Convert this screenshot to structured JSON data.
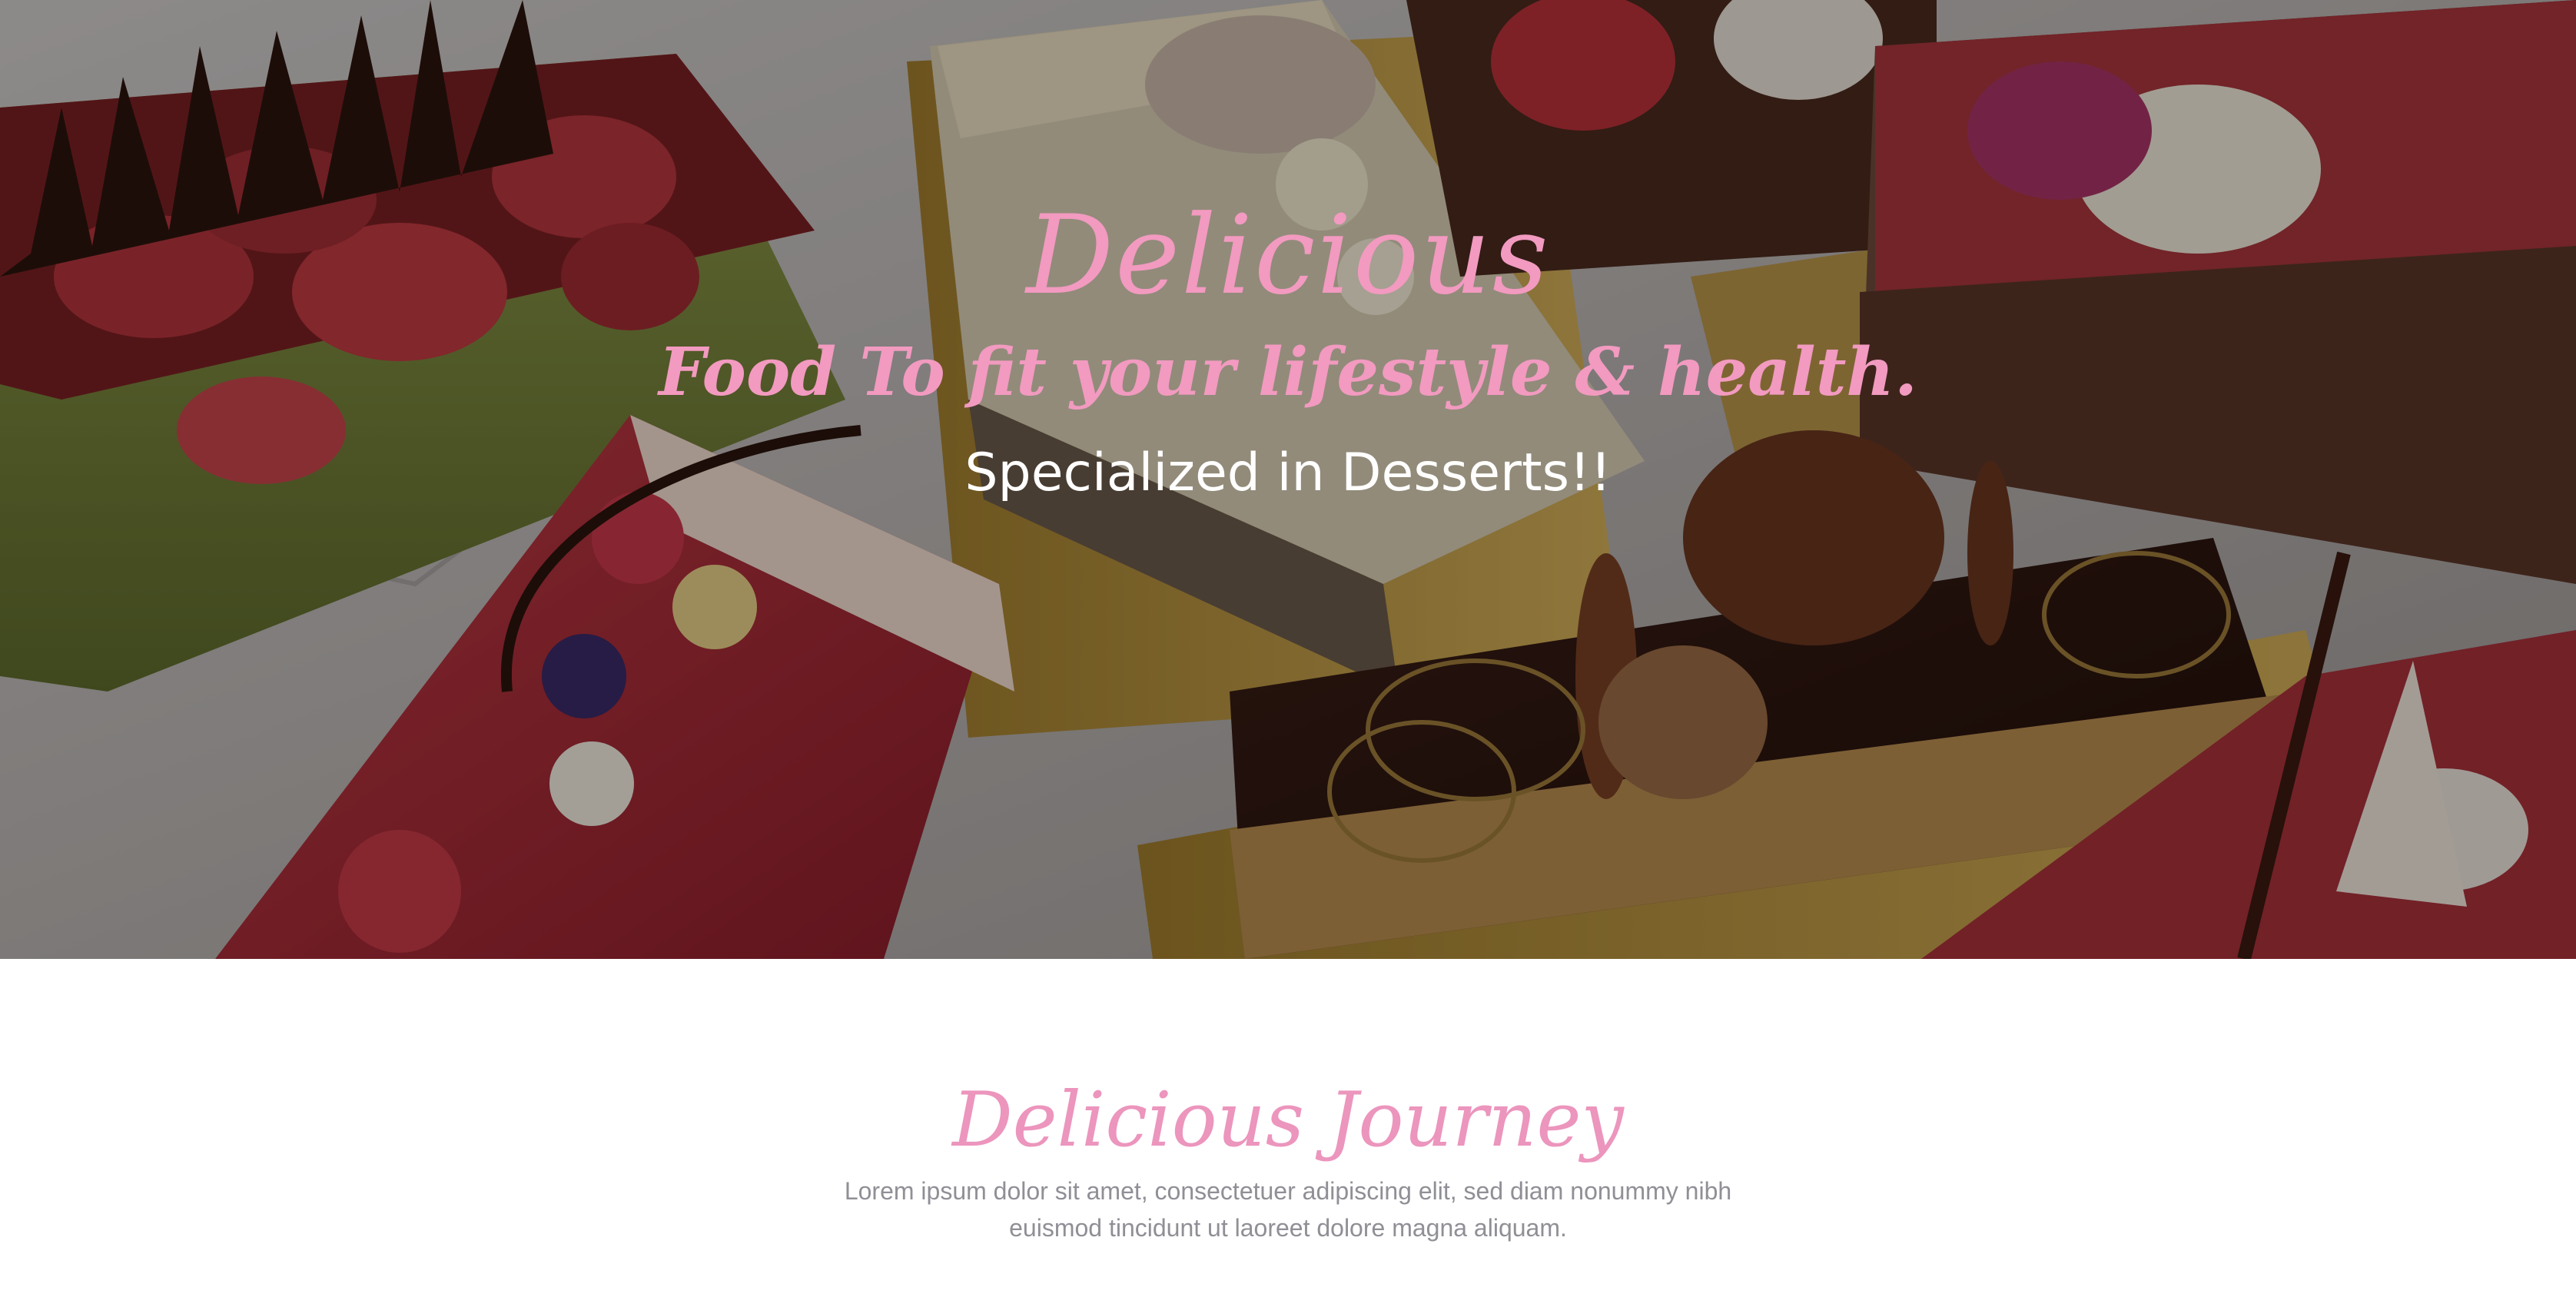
{
  "hero": {
    "title": "Delicious",
    "subtitle": "Food To fit your lifestyle & health.",
    "tagline": "Specialized in Desserts!!",
    "background": "photo of assorted layered cakes and pastries with strawberries and chocolate discs",
    "accent_color": "#f29ac0"
  },
  "journey": {
    "title": "Delicious Journey",
    "body": "Lorem ipsum dolor sit amet, consectetuer adipiscing elit, sed diam nonummy nibh euismod tincidunt ut laoreet dolore magna aliquam.",
    "title_color": "#ec95bd",
    "text_color": "#8f8f96"
  }
}
